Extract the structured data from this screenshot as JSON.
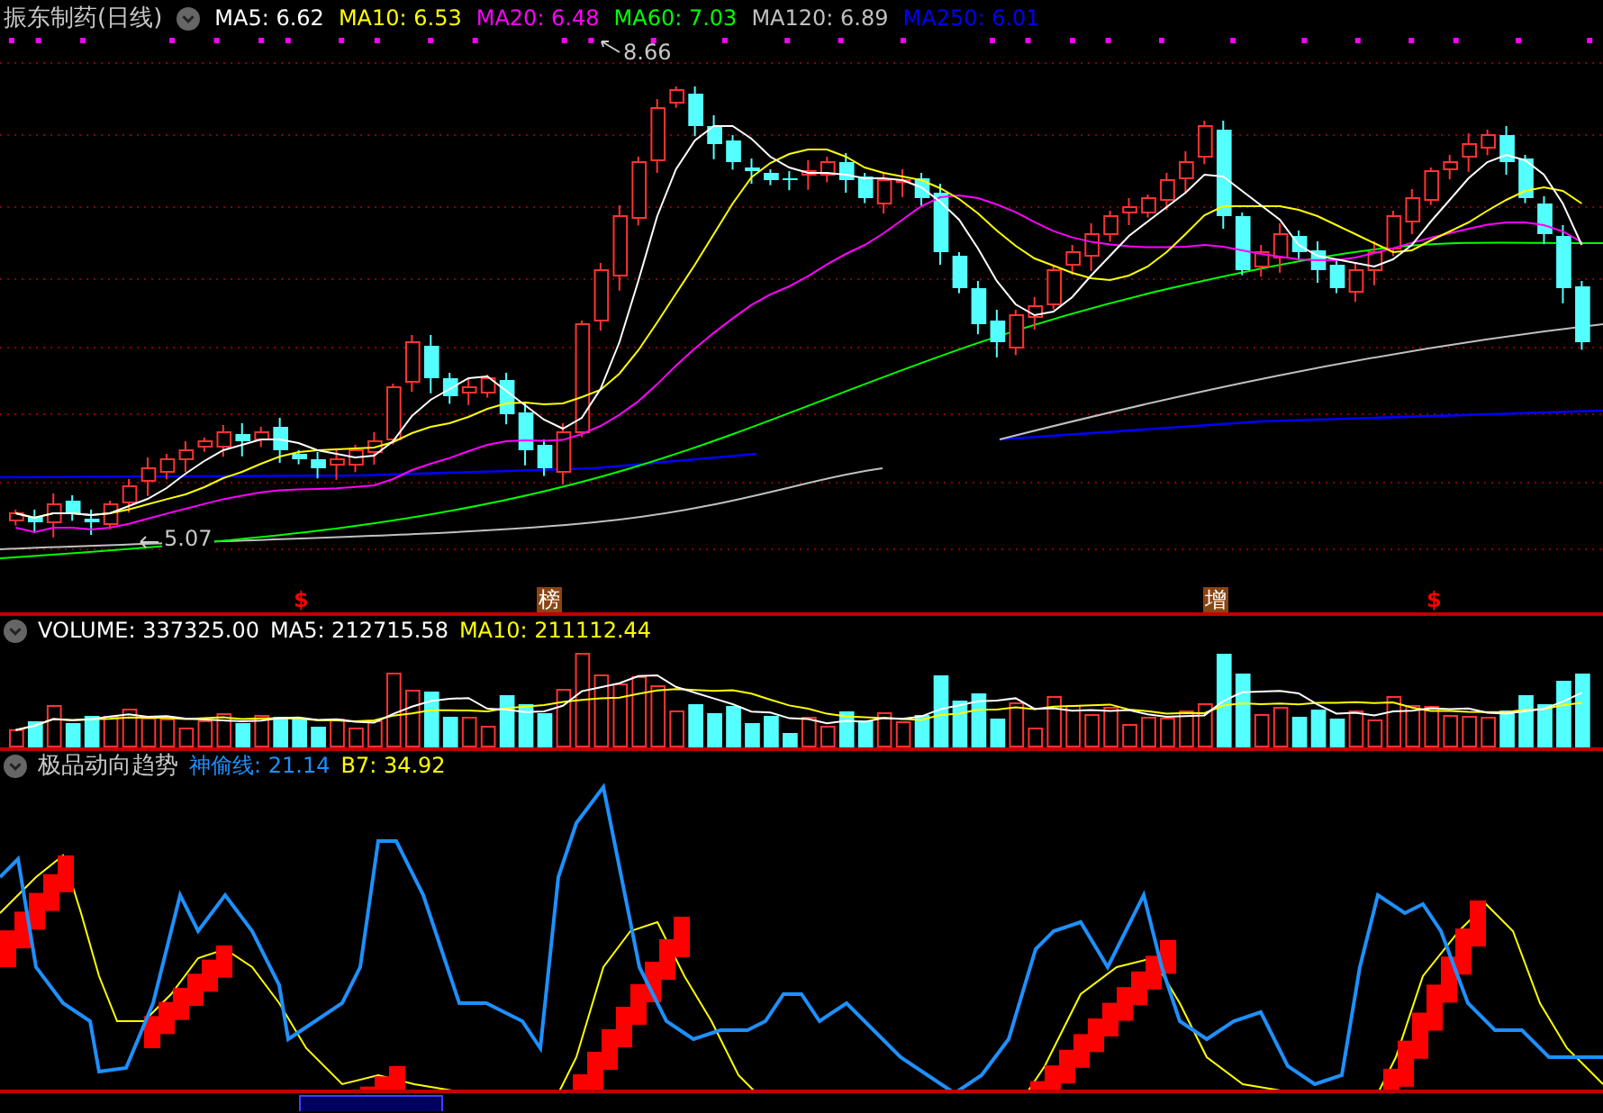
{
  "price_pane": {
    "title": "振东制药(日线)",
    "indicators": [
      {
        "label": "MA5: 6.62",
        "color": "#ffffff"
      },
      {
        "label": "MA10: 6.53",
        "color": "#ffff00"
      },
      {
        "label": "MA20: 6.48",
        "color": "#ff00ff"
      },
      {
        "label": "MA60: 7.03",
        "color": "#00ff00"
      },
      {
        "label": "MA120: 6.89",
        "color": "#c0c0c0"
      },
      {
        "label": "MA250: 6.01",
        "color": "#0000ff"
      }
    ],
    "high_label": "8.66",
    "low_label": "5.07",
    "markers": [
      {
        "text": "$",
        "kind": "dollar"
      },
      {
        "text": "榜",
        "kind": "badge"
      },
      {
        "text": "增",
        "kind": "badge"
      },
      {
        "text": "$",
        "kind": "dollar"
      }
    ]
  },
  "volume_pane": {
    "indicators": [
      {
        "label": "VOLUME: 337325.00",
        "color": "#ffffff"
      },
      {
        "label": "MA5: 212715.58",
        "color": "#ffffff"
      },
      {
        "label": "MA10: 211112.44",
        "color": "#ffff00"
      }
    ]
  },
  "indicator_pane": {
    "title": "极品动向趋势",
    "indicators": [
      {
        "label": "神偷线: 21.14",
        "color": "#1e90ff"
      },
      {
        "label": "B7: 34.92",
        "color": "#ffff00"
      }
    ]
  }
}
